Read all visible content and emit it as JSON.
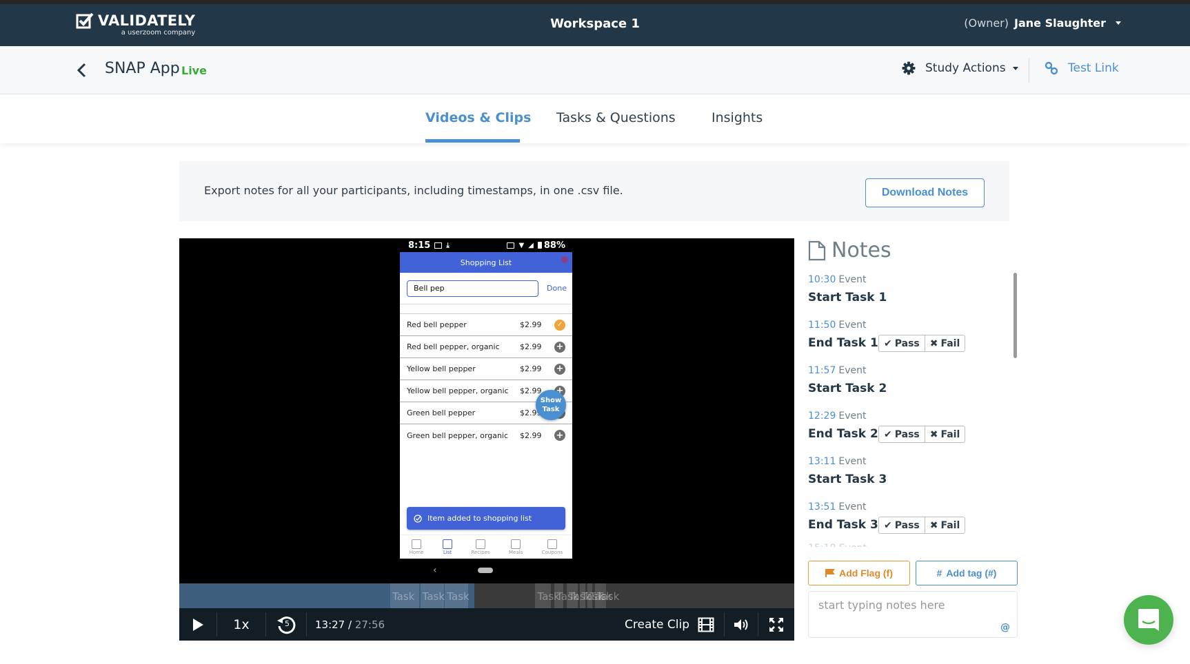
{
  "topbar": {
    "logo_name": "VALIDATELY",
    "logo_sub": "a userzoom company",
    "workspace": "Workspace 1",
    "user_role": "(Owner)",
    "user_name": "Jane Slaughter"
  },
  "subbar": {
    "study_name": "SNAP App",
    "status": "Live",
    "study_actions_label": "Study Actions",
    "test_link_label": "Test Link"
  },
  "tabs": [
    {
      "label": "Videos & Clips",
      "active": true
    },
    {
      "label": "Tasks & Questions",
      "active": false
    },
    {
      "label": "Insights",
      "active": false
    }
  ],
  "banner": {
    "text": "Export notes for all your participants, including timestamps, in one .csv file.",
    "button_label": "Download Notes"
  },
  "phone": {
    "status_time": "8:15",
    "battery": "88%",
    "app_title": "Shopping List",
    "search_value": "Bell pep",
    "done_label": "Done",
    "items": [
      {
        "name": "Red bell pepper",
        "price": "$2.99",
        "state": "checked"
      },
      {
        "name": "Red bell pepper, organic",
        "price": "$2.99",
        "state": "add"
      },
      {
        "name": "Yellow bell pepper",
        "price": "$2.99",
        "state": "add"
      },
      {
        "name": "Yellow bell pepper, organic",
        "price": "$2.99",
        "state": "add"
      },
      {
        "name": "Green bell pepper",
        "price": "$2.99",
        "state": "add"
      },
      {
        "name": "Green bell pepper, organic",
        "price": "$2.99",
        "state": "add"
      }
    ],
    "show_task_line1": "Show",
    "show_task_line2": "Task",
    "toast": "Item added to shopping list",
    "nav": [
      {
        "label": "Home",
        "active": false
      },
      {
        "label": "List",
        "active": true
      },
      {
        "label": "Recipes",
        "active": false
      },
      {
        "label": "Meals",
        "active": false
      },
      {
        "label": "Coupons",
        "active": false
      }
    ]
  },
  "player": {
    "current_time": "13:27",
    "separator": " / ",
    "duration": "27:56",
    "progress_fraction": 0.48,
    "speed": "1x",
    "rewind_seconds": "5",
    "create_clip_label": "Create Clip",
    "task_segment_label": "Task",
    "task_segments": [
      {
        "start": 0.343,
        "end": 0.39
      },
      {
        "start": 0.392,
        "end": 0.43
      },
      {
        "start": 0.432,
        "end": 0.47
      },
      {
        "start": 0.579,
        "end": 0.604
      },
      {
        "start": 0.61,
        "end": 0.624
      },
      {
        "start": 0.63,
        "end": 0.648
      },
      {
        "start": 0.651,
        "end": 0.66
      },
      {
        "start": 0.664,
        "end": 0.672
      },
      {
        "start": 0.676,
        "end": 0.694
      }
    ]
  },
  "notes": {
    "title": "Notes",
    "items": [
      {
        "time": "10:30",
        "type": "Event",
        "text": "Start Task 1",
        "passfail": false
      },
      {
        "time": "11:50",
        "type": "Event",
        "text": "End Task 1",
        "passfail": true
      },
      {
        "time": "11:57",
        "type": "Event",
        "text": "Start Task 2",
        "passfail": false
      },
      {
        "time": "12:29",
        "type": "Event",
        "text": "End Task 2",
        "passfail": true
      },
      {
        "time": "13:11",
        "type": "Event",
        "text": "Start Task 3",
        "passfail": false
      },
      {
        "time": "13:51",
        "type": "Event",
        "text": "End Task 3",
        "passfail": true
      }
    ],
    "pass_label": "Pass",
    "fail_label": "Fail",
    "add_flag_label": "Add Flag (f)",
    "add_tag_label": "Add tag (#)",
    "input_placeholder": "start typing notes here",
    "mention_symbol": "@"
  },
  "colors": {
    "brand_dark": "#223747",
    "accent_blue": "#4a8fd0",
    "live_green": "#3aa935",
    "flag_orange": "#e49a3d",
    "chat_green": "#4cb34f"
  }
}
